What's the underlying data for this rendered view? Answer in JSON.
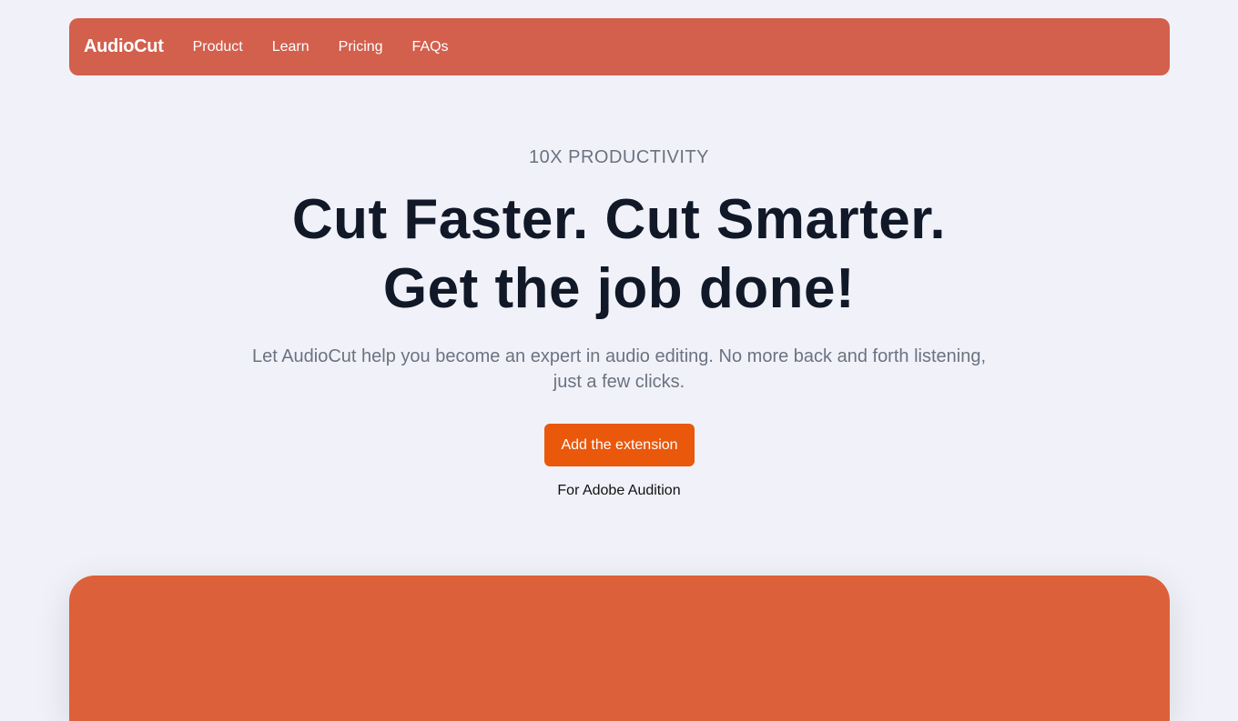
{
  "nav": {
    "brand": "AudioCut",
    "links": [
      "Product",
      "Learn",
      "Pricing",
      "FAQs"
    ]
  },
  "hero": {
    "eyebrow": "10X PRODUCTIVITY",
    "headline_line1": "Cut Faster. Cut Smarter.",
    "headline_line2": "Get the job done!",
    "subtext": "Let AudioCut help you become an expert in audio editing. No more back and forth listening, just a few clicks.",
    "cta_label": "Add the extension",
    "cta_note": "For Adobe Audition"
  },
  "colors": {
    "nav_background": "#d35f4d",
    "cta_background": "#ea580c",
    "panel_background": "#dc603a",
    "page_background": "#f1f2f9"
  }
}
